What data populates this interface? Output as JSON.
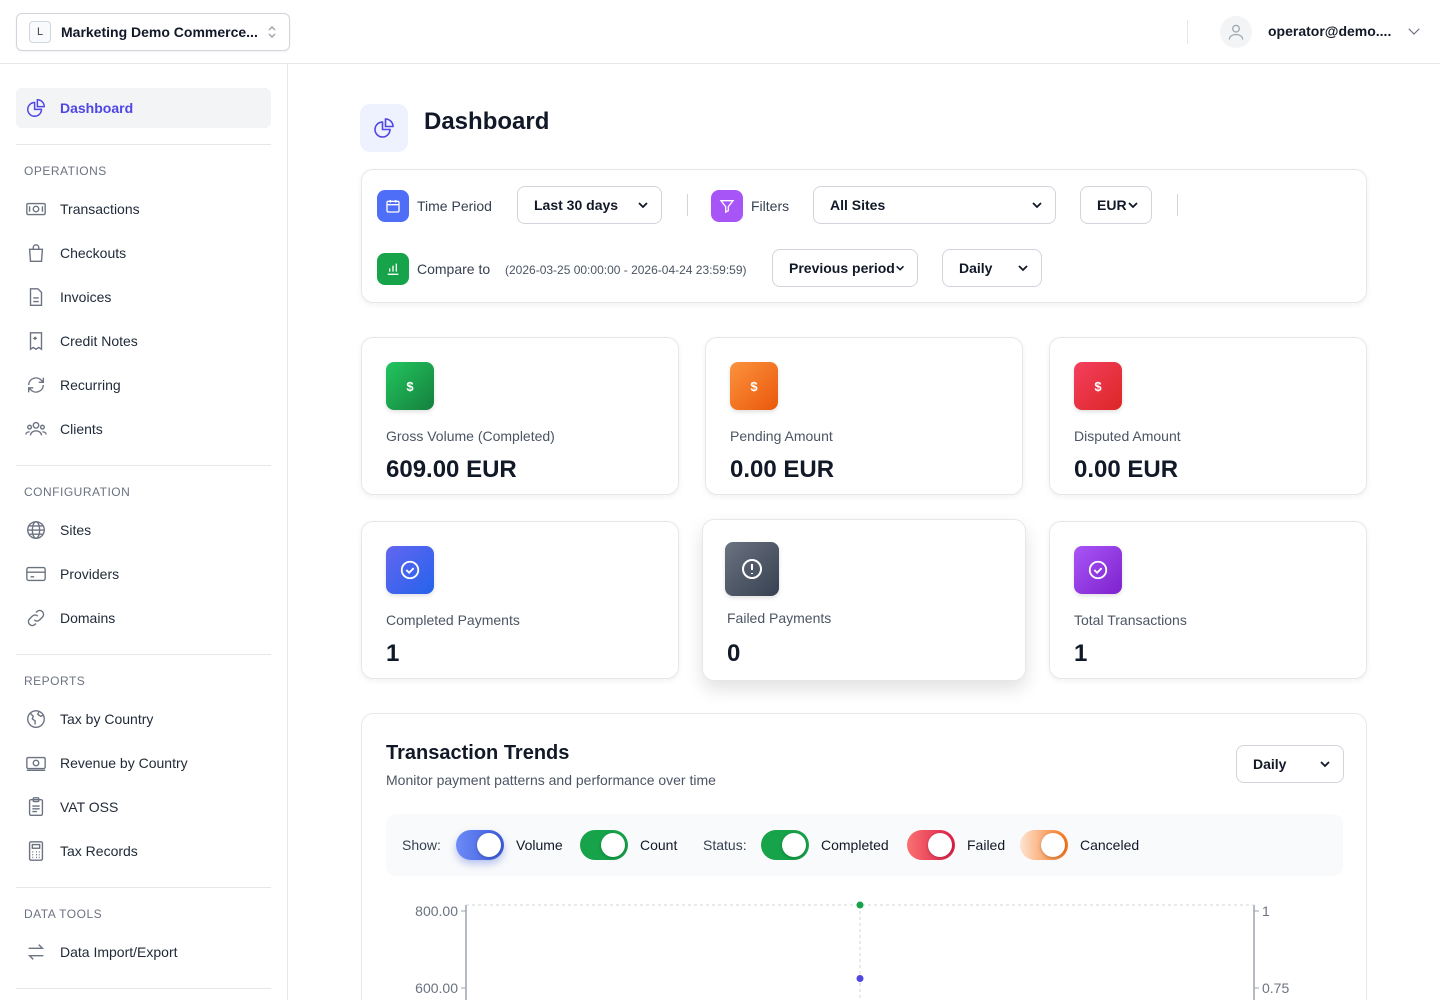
{
  "topbar": {
    "site_badge": "L",
    "site_name": "Marketing Demo Commerce...",
    "user_email": "operator@demo...."
  },
  "sidebar": {
    "dashboard": "Dashboard",
    "sections": [
      {
        "title": "OPERATIONS",
        "items": [
          {
            "label": "Transactions",
            "icon": "cash-icon"
          },
          {
            "label": "Checkouts",
            "icon": "shopping-bag-icon"
          },
          {
            "label": "Invoices",
            "icon": "document-icon"
          },
          {
            "label": "Credit Notes",
            "icon": "receipt-refund-icon"
          },
          {
            "label": "Recurring",
            "icon": "refresh-icon"
          },
          {
            "label": "Clients",
            "icon": "users-icon"
          }
        ]
      },
      {
        "title": "CONFIGURATION",
        "items": [
          {
            "label": "Sites",
            "icon": "globe-icon"
          },
          {
            "label": "Providers",
            "icon": "credit-card-icon"
          },
          {
            "label": "Domains",
            "icon": "link-icon"
          }
        ]
      },
      {
        "title": "REPORTS",
        "items": [
          {
            "label": "Tax by Country",
            "icon": "globe-americas-icon"
          },
          {
            "label": "Revenue by Country",
            "icon": "banknotes-icon"
          },
          {
            "label": "VAT OSS",
            "icon": "clipboard-icon"
          },
          {
            "label": "Tax Records",
            "icon": "calculator-icon"
          }
        ]
      },
      {
        "title": "DATA TOOLS",
        "items": [
          {
            "label": "Data Import/Export",
            "icon": "arrows-right-left-icon"
          }
        ]
      }
    ]
  },
  "page": {
    "title": "Dashboard"
  },
  "filters": {
    "time_period_label": "Time Period",
    "time_period_value": "Last 30 days",
    "filters_label": "Filters",
    "sites_value": "All Sites",
    "currency_value": "EUR",
    "compare_label": "Compare to",
    "compare_range": "(2026-03-25 00:00:00 - 2026-04-24 23:59:59)",
    "compare_value": "Previous period",
    "granularity_value": "Daily"
  },
  "colors": {
    "accent": "#4f46e5",
    "green": "#16a34a",
    "orange": "#f97316",
    "red": "#e11d48",
    "blue": "#4f46e5",
    "slate": "#4b5563",
    "purple": "#9333ea"
  },
  "stats": [
    {
      "label": "Gross Volume (Completed)",
      "value": "609.00 EUR",
      "icon": "dollar-icon"
    },
    {
      "label": "Pending Amount",
      "value": "0.00 EUR",
      "icon": "dollar-icon"
    },
    {
      "label": "Disputed Amount",
      "value": "0.00 EUR",
      "icon": "dollar-icon"
    },
    {
      "label": "Completed Payments",
      "value": "1",
      "icon": "check-circle-icon"
    },
    {
      "label": "Failed Payments",
      "value": "0",
      "icon": "exclamation-circle-icon"
    },
    {
      "label": "Total Transactions",
      "value": "1",
      "icon": "check-circle-icon"
    }
  ],
  "trends": {
    "title": "Transaction Trends",
    "subtitle": "Monitor payment patterns and performance over time",
    "granularity": "Daily",
    "show_label": "Show:",
    "status_label": "Status:",
    "toggles": {
      "volume": {
        "label": "Volume",
        "on": true
      },
      "count": {
        "label": "Count",
        "on": true
      },
      "completed": {
        "label": "Completed",
        "on": true
      },
      "failed": {
        "label": "Failed",
        "on": true
      },
      "canceled": {
        "label": "Canceled",
        "on": true
      }
    }
  },
  "chart_data": {
    "type": "line",
    "left_axis_ticks": [
      "800.00",
      "600.00"
    ],
    "right_axis_ticks": [
      "1",
      "0.75"
    ],
    "points": [
      {
        "series": "Count",
        "y": 1,
        "axis": "right",
        "color": "#16a34a"
      },
      {
        "series": "Volume",
        "y": 609.0,
        "axis": "left",
        "color": "#4f46e5"
      }
    ]
  }
}
